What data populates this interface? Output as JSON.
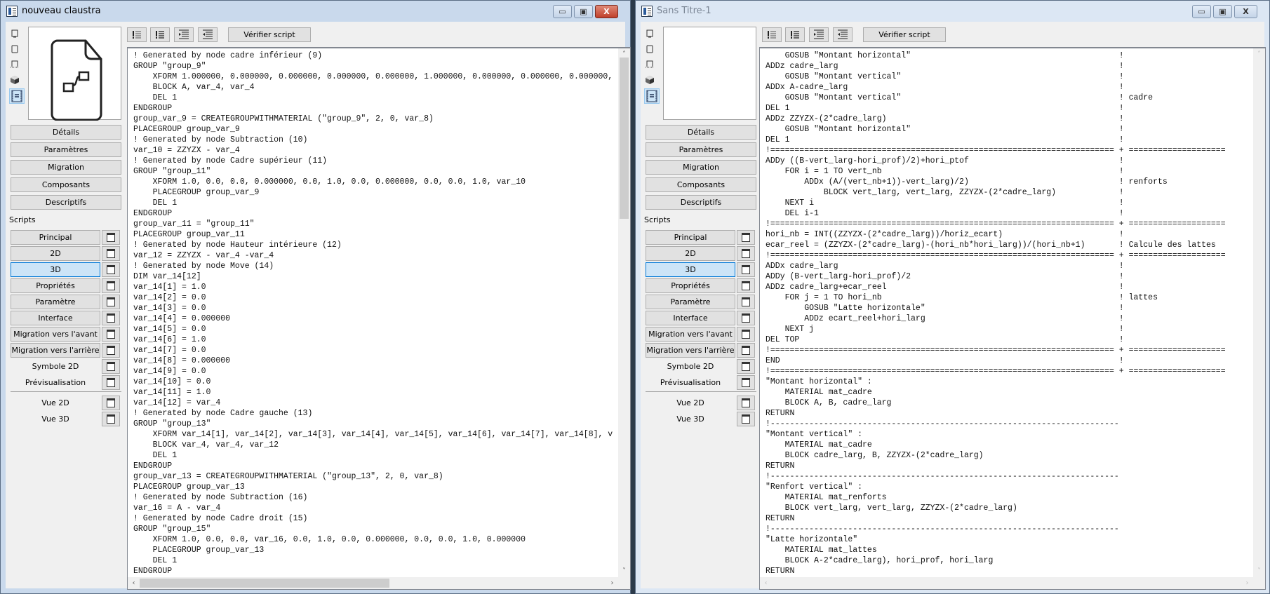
{
  "windows": [
    {
      "title": "nouveau claustra",
      "active": true,
      "preview_icon": "file-diagram-icon",
      "code": [
        "! Generated by node cadre inférieur (9)",
        "GROUP \"group_9\"",
        "    XFORM 1.000000, 0.000000, 0.000000, 0.000000, 0.000000, 1.000000, 0.000000, 0.000000, 0.000000,",
        "    BLOCK A, var_4, var_4",
        "    DEL 1",
        "ENDGROUP",
        "group_var_9 = CREATEGROUPWITHMATERIAL (\"group_9\", 2, 0, var_8)",
        "PLACEGROUP group_var_9",
        "! Generated by node Subtraction (10)",
        "var_10 = ZZYZX - var_4",
        "! Generated by node Cadre supérieur (11)",
        "GROUP \"group_11\"",
        "    XFORM 1.0, 0.0, 0.0, 0.000000, 0.0, 1.0, 0.0, 0.000000, 0.0, 0.0, 1.0, var_10",
        "    PLACEGROUP group_var_9",
        "    DEL 1",
        "ENDGROUP",
        "group_var_11 = \"group_11\"",
        "PLACEGROUP group_var_11",
        "! Generated by node Hauteur intérieure (12)",
        "var_12 = ZZYZX - var_4 -var_4",
        "! Generated by node Move (14)",
        "DIM var_14[12]",
        "var_14[1] = 1.0",
        "var_14[2] = 0.0",
        "var_14[3] = 0.0",
        "var_14[4] = 0.000000",
        "var_14[5] = 0.0",
        "var_14[6] = 1.0",
        "var_14[7] = 0.0",
        "var_14[8] = 0.000000",
        "var_14[9] = 0.0",
        "var_14[10] = 0.0",
        "var_14[11] = 1.0",
        "var_14[12] = var_4",
        "! Generated by node Cadre gauche (13)",
        "GROUP \"group_13\"",
        "    XFORM var_14[1], var_14[2], var_14[3], var_14[4], var_14[5], var_14[6], var_14[7], var_14[8], v",
        "    BLOCK var_4, var_4, var_12",
        "    DEL 1",
        "ENDGROUP",
        "group_var_13 = CREATEGROUPWITHMATERIAL (\"group_13\", 2, 0, var_8)",
        "PLACEGROUP group_var_13",
        "! Generated by node Subtraction (16)",
        "var_16 = A - var_4",
        "! Generated by node Cadre droit (15)",
        "GROUP \"group_15\"",
        "    XFORM 1.0, 0.0, 0.0, var_16, 0.0, 1.0, 0.0, 0.000000, 0.0, 0.0, 1.0, 0.000000",
        "    PLACEGROUP group_var_13",
        "    DEL 1",
        "ENDGROUP"
      ]
    },
    {
      "title": "Sans Titre-1",
      "active": false,
      "preview_icon": "",
      "code": [
        {
          "code": "    GOSUB \"Montant horizontal\"",
          "mark": "!",
          "comment": ""
        },
        {
          "code": "ADDz cadre_larg",
          "mark": "!",
          "comment": ""
        },
        {
          "code": "    GOSUB \"Montant vertical\"",
          "mark": "!",
          "comment": ""
        },
        {
          "code": "ADDx A-cadre_larg",
          "mark": "!",
          "comment": ""
        },
        {
          "code": "    GOSUB \"Montant vertical\"",
          "mark": "!",
          "comment": "cadre"
        },
        {
          "code": "DEL 1",
          "mark": "!",
          "comment": ""
        },
        {
          "code": "ADDz ZZYZX-(2*cadre_larg)",
          "mark": "!",
          "comment": ""
        },
        {
          "code": "    GOSUB \"Montant horizontal\"",
          "mark": "!",
          "comment": ""
        },
        {
          "code": "DEL 1",
          "mark": "!",
          "comment": ""
        },
        {
          "code": "!=======================================================================",
          "mark": "+",
          "comment": "===================="
        },
        {
          "code": "ADDy ((B-vert_larg-hori_prof)/2)+hori_ptof",
          "mark": "!",
          "comment": ""
        },
        {
          "code": "    FOR i = 1 TO vert_nb",
          "mark": "!",
          "comment": ""
        },
        {
          "code": "        ADDx (A/(vert_nb+1))-vert_larg)/2)",
          "mark": "!",
          "comment": "renforts"
        },
        {
          "code": "            BLOCK vert_larg, vert_larg, ZZYZX-(2*cadre_larg)",
          "mark": "!",
          "comment": ""
        },
        {
          "code": "    NEXT i",
          "mark": "!",
          "comment": ""
        },
        {
          "code": "    DEL i-1",
          "mark": "!",
          "comment": ""
        },
        {
          "code": "!=======================================================================",
          "mark": "+",
          "comment": "===================="
        },
        {
          "code": "hori_nb = INT((ZZYZX-(2*cadre_larg))/horiz_ecart)",
          "mark": "!",
          "comment": ""
        },
        {
          "code": "ecar_reel = (ZZYZX-(2*cadre_larg)-(hori_nb*hori_larg))/(hori_nb+1)",
          "mark": "!",
          "comment": "Calcule des lattes"
        },
        {
          "code": "!=======================================================================",
          "mark": "+",
          "comment": "===================="
        },
        {
          "code": "ADDx cadre_larg",
          "mark": "!",
          "comment": ""
        },
        {
          "code": "ADDy (B-vert_larg-hori_prof)/2",
          "mark": "!",
          "comment": ""
        },
        {
          "code": "ADDz cadre_larg+ecar_reel",
          "mark": "!",
          "comment": ""
        },
        {
          "code": "    FOR j = 1 TO hori_nb",
          "mark": "!",
          "comment": "lattes"
        },
        {
          "code": "        GOSUB \"Latte horizontale\"",
          "mark": "!",
          "comment": ""
        },
        {
          "code": "        ADDz ecart_reel+hori_larg",
          "mark": "!",
          "comment": ""
        },
        {
          "code": "    NEXT j",
          "mark": "!",
          "comment": ""
        },
        {
          "code": "DEL TOP",
          "mark": "!",
          "comment": ""
        },
        {
          "code": "!=======================================================================",
          "mark": "+",
          "comment": "===================="
        },
        {
          "code": "END",
          "mark": "!",
          "comment": ""
        },
        {
          "code": "!=======================================================================",
          "mark": "+",
          "comment": "===================="
        },
        {
          "code": "\"Montant horizontal\" :",
          "mark": "",
          "comment": ""
        },
        {
          "code": "    MATERIAL mat_cadre",
          "mark": "",
          "comment": ""
        },
        {
          "code": "    BLOCK A, B, cadre_larg",
          "mark": "",
          "comment": ""
        },
        {
          "code": "RETURN",
          "mark": "",
          "comment": ""
        },
        {
          "code": "!------------------------------------------------------------------------",
          "mark": "",
          "comment": ""
        },
        {
          "code": "\"Montant vertical\" :",
          "mark": "",
          "comment": ""
        },
        {
          "code": "    MATERIAL mat_cadre",
          "mark": "",
          "comment": ""
        },
        {
          "code": "    BLOCK cadre_larg, B, ZZYZX-(2*cadre_larg)",
          "mark": "",
          "comment": ""
        },
        {
          "code": "RETURN",
          "mark": "",
          "comment": ""
        },
        {
          "code": "!------------------------------------------------------------------------",
          "mark": "",
          "comment": ""
        },
        {
          "code": "\"Renfort vertical\" :",
          "mark": "",
          "comment": ""
        },
        {
          "code": "    MATERIAL mat_renforts",
          "mark": "",
          "comment": ""
        },
        {
          "code": "    BLOCK vert_larg, vert_larg, ZZYZX-(2*cadre_larg)",
          "mark": "",
          "comment": ""
        },
        {
          "code": "RETURN",
          "mark": "",
          "comment": ""
        },
        {
          "code": "!------------------------------------------------------------------------",
          "mark": "",
          "comment": ""
        },
        {
          "code": "\"Latte horizontale\"",
          "mark": "",
          "comment": ""
        },
        {
          "code": "    MATERIAL mat_lattes",
          "mark": "",
          "comment": ""
        },
        {
          "code": "    BLOCK A-2*cadre_larg), hori_prof, hori_larg",
          "mark": "",
          "comment": ""
        },
        {
          "code": "RETURN",
          "mark": "",
          "comment": ""
        }
      ]
    }
  ],
  "window_controls": {
    "minimize": "▭",
    "maximize": "▣",
    "close": "X"
  },
  "view_icons": [
    "2d-view-icon",
    "3d-frame-icon",
    "floor-plan-icon",
    "3d-object-icon",
    "script-editor-icon"
  ],
  "toolbar": {
    "icons": [
      "comment-icon",
      "uncomment-icon",
      "indent-icon",
      "outdent-icon"
    ],
    "check_script": "Vérifier script"
  },
  "sidebar": {
    "sections": [
      "Détails",
      "Paramètres",
      "Migration",
      "Composants",
      "Descriptifs"
    ],
    "scripts_label": "Scripts",
    "scripts": [
      {
        "label": "Principal",
        "style": "button"
      },
      {
        "label": "2D",
        "style": "button"
      },
      {
        "label": "3D",
        "style": "button",
        "selected": true
      },
      {
        "label": "Propriétés",
        "style": "button"
      },
      {
        "label": "Paramètre",
        "style": "button"
      },
      {
        "label": "Interface",
        "style": "button"
      },
      {
        "label": "Migration vers l'avant",
        "style": "button"
      },
      {
        "label": "Migration vers l'arrière",
        "style": "button"
      },
      {
        "label": "Symbole 2D",
        "style": "flat"
      },
      {
        "label": "Prévisualisation",
        "style": "flat"
      }
    ],
    "views": [
      "Vue 2D",
      "Vue 3D"
    ]
  },
  "colors": {
    "active_title": "#c9d9ec",
    "inactive_title": "#dce7f4",
    "close_button": "#c0402b",
    "selected": "#cce4f7"
  }
}
